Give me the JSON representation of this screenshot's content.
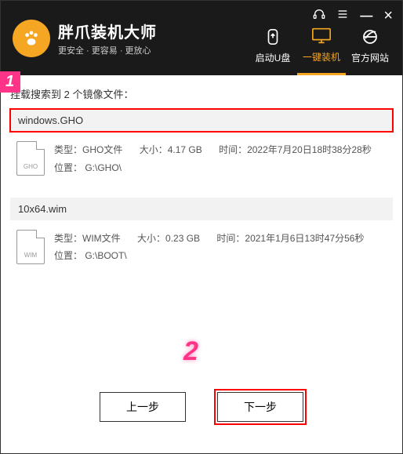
{
  "titlebar": {
    "brand_title": "胖爪装机大师",
    "brand_sub": "更安全 · 更容易 · 更放心"
  },
  "nav": {
    "usb": "启动U盘",
    "install": "一键装机",
    "site": "官方网站"
  },
  "search_line_prefix": "挂载搜索到 ",
  "search_count": "2",
  "search_line_suffix": " 个镜像文件：",
  "files": [
    {
      "name": "windows.GHO",
      "ext": "GHO",
      "type_label": "类型：GHO文件",
      "size_label": "大小：4.17 GB",
      "time_label": "时间：2022年7月20日18时38分28秒",
      "loc_label": "位置： G:\\GHO\\"
    },
    {
      "name": "10x64.wim",
      "ext": "WIM",
      "type_label": "类型：WIM文件",
      "size_label": "大小：0.23 GB",
      "time_label": "时间：2021年1月6日13时47分56秒",
      "loc_label": "位置： G:\\BOOT\\"
    }
  ],
  "buttons": {
    "prev": "上一步",
    "next": "下一步"
  },
  "annotations": {
    "one": "1",
    "two": "2"
  }
}
